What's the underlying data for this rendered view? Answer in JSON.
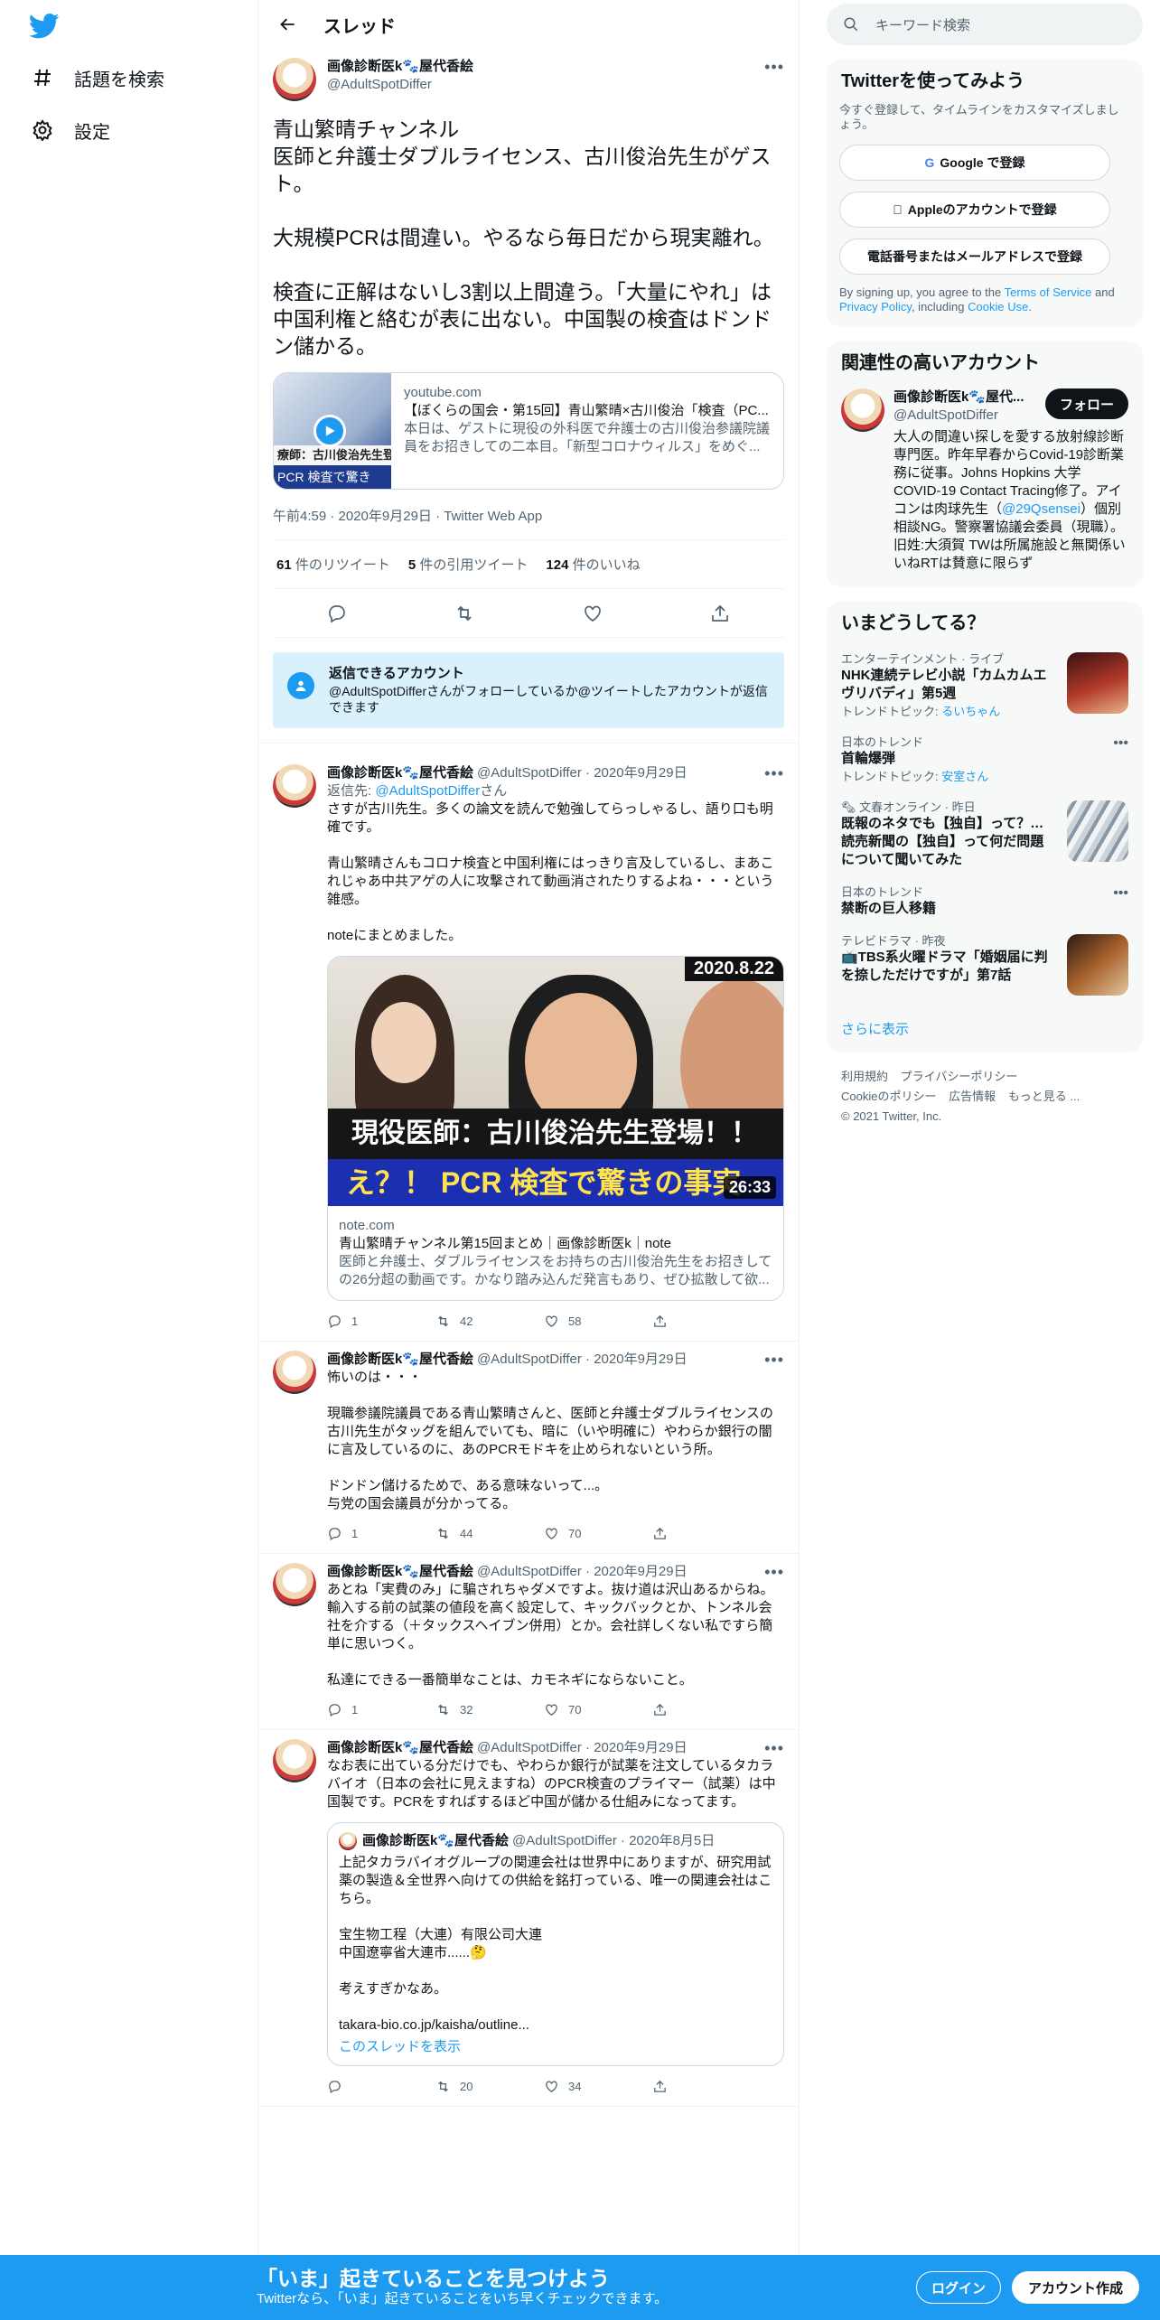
{
  "nav": {
    "explore_label": "話題を検索",
    "settings_label": "設定"
  },
  "header": {
    "title": "スレッド"
  },
  "main_tweet": {
    "name": "画像診断医k🐾屋代香絵",
    "handle": "@AdultSpotDiffer",
    "text": "青山繁晴チャンネル\n医師と弁護士ダブルライセンス、古川俊治先生がゲスト。\n\n大規模PCRは間違い。やるなら毎日だから現実離れ。\n\n検査に正解はないし3割以上間違う。「大量にやれ」は中国利権と絡むが表に出ない。中国製の検査はドンドン儲かる。",
    "card": {
      "thumb_band_top": "療師：古川俊治先生登場",
      "thumb_band": "PCR 検査で驚き",
      "domain": "youtube.com",
      "title": "【ぼくらの国会・第15回】青山繁晴×古川俊治「検査（PC...",
      "desc": "本日は、ゲストに現役の外科医で弁護士の古川俊治参議院議員をお招きしての二本目。「新型コロナウィルス」をめぐ..."
    },
    "meta": "午前4:59 · 2020年9月29日 · Twitter Web App",
    "retweets_num": "61",
    "retweets_label": "件のリツイート",
    "quotes_num": "5",
    "quotes_label": "件の引用ツイート",
    "likes_num": "124",
    "likes_label": "件のいいね"
  },
  "reply_notice": {
    "title": "返信できるアカウント",
    "text": "@AdultSpotDifferさんがフォローしているか@ツイートしたアカウントが返信できます"
  },
  "replies": [
    {
      "name": "画像診断医k🐾屋代香絵",
      "handle": "@AdultSpotDiffer · 2020年9月29日",
      "to_prefix": "返信先: ",
      "to_handle": "@AdultSpotDiffer",
      "to_suffix": "さん",
      "text": "さすが古川先生。多くの論文を読んで勉強してらっしゃるし、語り口も明確です。\n\n青山繁晴さんもコロナ検査と中国利権にはっきり言及しているし、まあこれじゃあ中共アゲの人に攻撃されて動画消されたりするよね・・・という雑感。\n\nnoteにまとめました。",
      "card": {
        "date": "2020.8.22",
        "cap1": "現役医師：古川俊治先生登場！！",
        "cap2": "え？！ PCR 検査で驚きの事実",
        "duration": "26:33",
        "domain": "note.com",
        "title": "青山繁晴チャンネル第15回まとめ｜画像診断医k｜note",
        "desc": "医師と弁護士、ダブルライセンスをお持ちの古川俊治先生をお招きしての26分超の動画です。かなり踏み込んだ発言もあり、ぜひ拡散して欲..."
      },
      "replies": "1",
      "retweets": "42",
      "likes": "58"
    },
    {
      "name": "画像診断医k🐾屋代香絵",
      "handle": "@AdultSpotDiffer · 2020年9月29日",
      "text": "怖いのは・・・\n\n現職参議院議員である青山繁晴さんと、医師と弁護士ダブルライセンスの古川先生がタッグを組んでいても、暗に（いや明確に）やわらか銀行の闇に言及しているのに、あのPCRモドキを止められないという所。\n\nドンドン儲けるためで、ある意味ないって...。\n与党の国会議員が分かってる。",
      "replies": "1",
      "retweets": "44",
      "likes": "70"
    },
    {
      "name": "画像診断医k🐾屋代香絵",
      "handle": "@AdultSpotDiffer · 2020年9月29日",
      "text": "あとね「実費のみ」に騙されちゃダメですよ。抜け道は沢山あるからね。輸入する前の試薬の値段を高く設定して、キックバックとか、トンネル会社を介する（＋タックスヘイブン併用）とか。会社詳しくない私ですら簡単に思いつく。\n\n私達にできる一番簡単なことは、カモネギにならないこと。",
      "replies": "1",
      "retweets": "32",
      "likes": "70"
    },
    {
      "name": "画像診断医k🐾屋代香絵",
      "handle": "@AdultSpotDiffer · 2020年9月29日",
      "text": "なお表に出ている分だけでも、やわらか銀行が試薬を注文しているタカラバイオ（日本の会社に見えますね）のPCR検査のプライマー（試薬）は中国製です。PCRをすればするほど中国が儲かる仕組みになってます。",
      "quote": {
        "name": "画像診断医k🐾屋代香絵",
        "handle": "@AdultSpotDiffer · 2020年8月5日",
        "text": "上記タカラバイオグループの関連会社は世界中にありますが、研究用試薬の製造＆全世界へ向けての供給を銘打っている、唯一の関連会社はこちら。\n\n宝生物工程（大連）有限公司大連\n中国遼寧省大連市......🤔\n\n考えすぎかなあ。\n\ntakara-bio.co.jp/kaisha/outline...",
        "link": "このスレッドを表示"
      },
      "replies": "",
      "retweets": "20",
      "likes": "34"
    }
  ],
  "search": {
    "placeholder": "キーワード検索"
  },
  "signup": {
    "title": "Twitterを使ってみよう",
    "sub": "今すぐ登録して、タイムラインをカスタマイズしましょう。",
    "google": "Google で登録",
    "apple": "Appleのアカウントで登録",
    "phone": "電話番号またはメールアドレスで登録",
    "tos_1": "By signing up, you agree to the ",
    "tos_terms": "Terms of Service",
    "tos_2": " and ",
    "tos_privacy": "Privacy Policy",
    "tos_3": ", including ",
    "tos_cookie": "Cookie Use",
    "tos_4": "."
  },
  "related": {
    "title": "関連性の高いアカウント",
    "name": "画像診断医k🐾屋代...",
    "handle": "@AdultSpotDiffer",
    "follow": "フォロー",
    "bio_1": "大人の間違い探しを愛する放射線診断専門医。昨年早春からCovid-19診断業務に従事。Johns Hopkins 大学 COVID-19 Contact Tracing修了。アイコンは肉球先生（",
    "bio_link": "@29Qsensei",
    "bio_2": "）個別相談NG。警察署協議会委員（現職）。旧姓:大須賀 TWは所属施設と無関係いいねRTは賛意に限らず"
  },
  "trends": {
    "title": "いまどうしてる？",
    "items": [
      {
        "cat": "エンターテインメント · ライブ",
        "title": "NHK連続テレビ小説「カムカムエヴリバディ」第5週",
        "topic_label": "トレンドトピック: ",
        "topic": "るいちゃん"
      },
      {
        "cat": "日本のトレンド",
        "title": "首輪爆弾",
        "topic_label": "トレンドトピック: ",
        "topic": "安室さん"
      },
      {
        "cat": "🗞 文春オンライン · 昨日",
        "title": "既報のネタでも【独自】って？…読売新聞の【独自】って何だ問題について聞いてみた",
        "topic_label": "",
        "topic": ""
      },
      {
        "cat": "日本のトレンド",
        "title": "禁断の巨人移籍",
        "topic_label": "",
        "topic": ""
      },
      {
        "cat": "テレビドラマ · 昨夜",
        "title": "📺TBS系火曜ドラマ「婚姻届に判を捺しただけですが」第7話",
        "topic_label": "",
        "topic": ""
      }
    ],
    "show_more": "さらに表示"
  },
  "footer": {
    "terms": "利用規約",
    "privacy": "プライバシーポリシー",
    "cookie": "Cookieのポリシー",
    "ads": "広告情報",
    "more": "もっと見る ...",
    "copyright": "© 2021 Twitter, Inc."
  },
  "bottom": {
    "title": "「いま」起きていることを見つけよう",
    "sub": "Twitterなら、「いま」起きていることをいち早くチェックできます。",
    "login": "ログイン",
    "signup": "アカウント作成"
  },
  "colors": {
    "accent": "#1d9bf0",
    "notice_bg": "#d8f1fd",
    "text": "#0f1419",
    "muted": "#536471"
  }
}
